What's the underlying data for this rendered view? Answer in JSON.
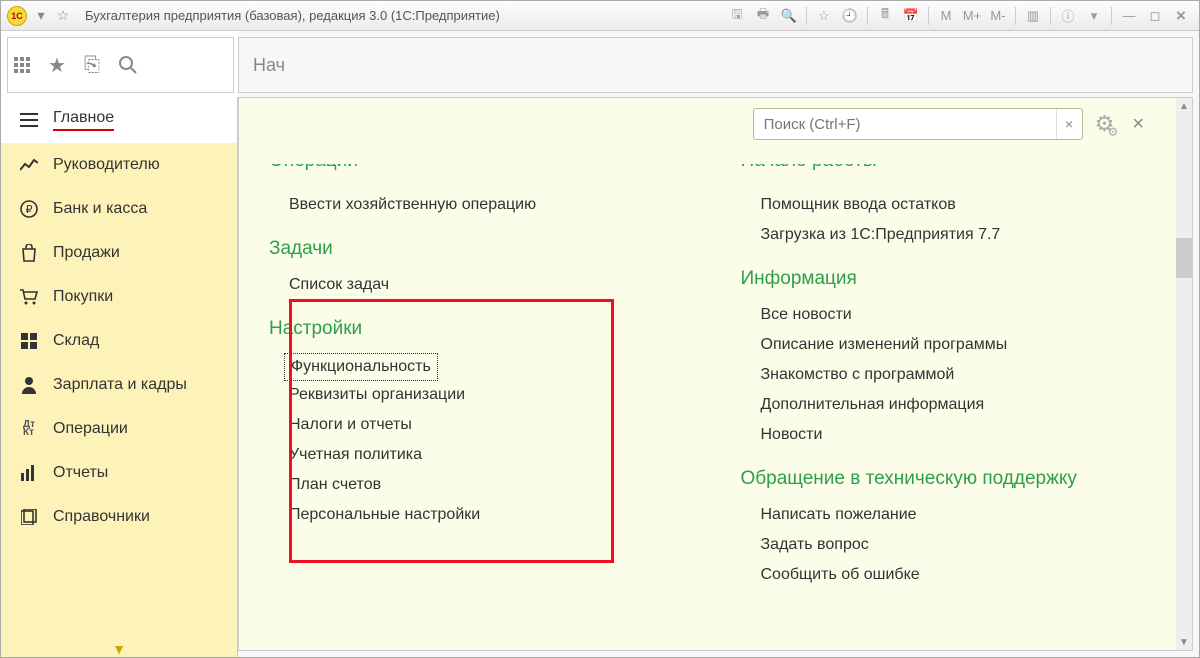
{
  "titlebar": {
    "logo": "1С",
    "title": "Бухгалтерия предприятия (базовая), редакция 3.0  (1С:Предприятие)",
    "mem": {
      "m": "M",
      "mplus": "M+",
      "mminus": "M-"
    }
  },
  "breadcrumb": {
    "text": "Нач"
  },
  "sidebar": {
    "items": [
      {
        "label": "Главное",
        "icon": "menu",
        "active": true
      },
      {
        "label": "Руководителю",
        "icon": "chart"
      },
      {
        "label": "Банк и касса",
        "icon": "ruble"
      },
      {
        "label": "Продажи",
        "icon": "bag"
      },
      {
        "label": "Покупки",
        "icon": "cart"
      },
      {
        "label": "Склад",
        "icon": "boxes"
      },
      {
        "label": "Зарплата и кадры",
        "icon": "person"
      },
      {
        "label": "Операции",
        "icon": "dtkt"
      },
      {
        "label": "Отчеты",
        "icon": "bars"
      },
      {
        "label": "Справочники",
        "icon": "books"
      }
    ]
  },
  "search": {
    "placeholder": "Поиск (Ctrl+F)"
  },
  "content": {
    "leftCol": {
      "cutHeader1": "Операции",
      "cutLinks1": [
        "Ввести хозяйственную операцию"
      ],
      "sec2": "Задачи",
      "sec2links": [
        "Список задач"
      ],
      "sec3": "Настройки",
      "sec3links": [
        "Функциональность",
        "Реквизиты организации",
        "Налоги и отчеты",
        "Учетная политика",
        "План счетов",
        "Персональные настройки"
      ]
    },
    "rightCol": {
      "cutHeader1": "Начало работы",
      "cutLinks1": [
        "Помощник ввода остатков",
        "Загрузка из 1С:Предприятия 7.7"
      ],
      "sec2": "Информация",
      "sec2links": [
        "Все новости",
        "Описание изменений программы",
        "Знакомство с программой",
        "Дополнительная информация",
        "Новости"
      ],
      "sec3": "Обращение в техническую поддержку",
      "sec3links": [
        "Написать пожелание",
        "Задать вопрос",
        "Сообщить об ошибке"
      ]
    }
  }
}
